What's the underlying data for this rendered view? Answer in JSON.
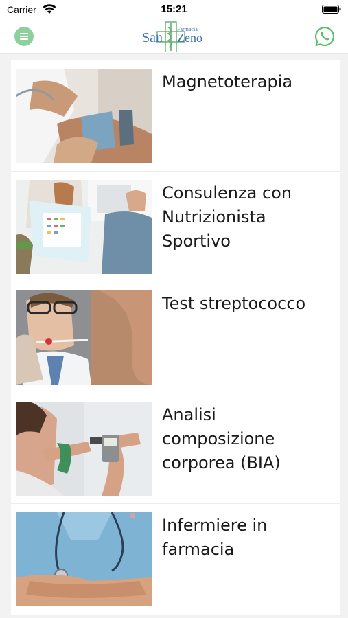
{
  "status_bar": {
    "carrier": "Carrier",
    "time": "15:21"
  },
  "header": {
    "logo": {
      "word_left": "San",
      "word_right": "Zeno",
      "small_text": "Farmacia",
      "color": "#3c6fb4",
      "accent": "#5fae6b"
    },
    "menu_icon": "hamburger-icon",
    "whatsapp_icon": "whatsapp-icon",
    "accent": "#8ed09d"
  },
  "services": [
    {
      "title": "Magnetoterapia",
      "image": "magnetotherapy-photo"
    },
    {
      "title": "Consulenza con Nutrizionista Sportivo",
      "image": "nutritionist-photo"
    },
    {
      "title": "Test streptococco",
      "image": "strep-test-photo"
    },
    {
      "title": "Analisi composizione corporea (BIA)",
      "image": "bia-analysis-photo"
    },
    {
      "title": "Infermiere in farmacia",
      "image": "nurse-photo"
    }
  ]
}
